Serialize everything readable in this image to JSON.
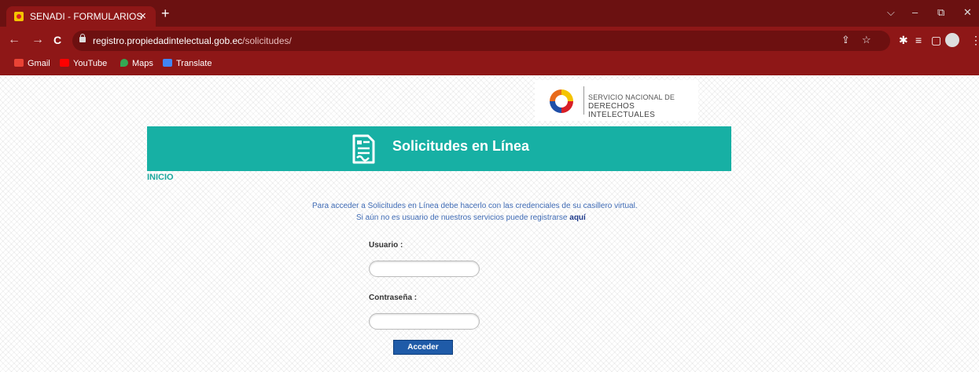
{
  "browser": {
    "tab_title": "SENADI - FORMULARIOS",
    "tab_close": "×",
    "new_tab": "+",
    "window_controls": {
      "dropdown": "⌵",
      "minimize": "–",
      "restore": "⧉",
      "close": "✕"
    },
    "nav": {
      "back": "←",
      "forward": "→",
      "reload": "C"
    },
    "url_host": "registro.propiedadintelectual.gob.ec",
    "url_path": "/solicitudes/",
    "omnibox_icons": {
      "share": "⇪",
      "bookmark": "☆"
    },
    "extension_icons": {
      "extensions": "✱",
      "reading_list": "≡",
      "side_panel": "▢"
    },
    "bookmarks": [
      {
        "label": "Gmail",
        "icon": "gmail-icon",
        "color": "#ea4335"
      },
      {
        "label": "YouTube",
        "icon": "youtube-icon",
        "color": "#ff0000"
      },
      {
        "label": "Maps",
        "icon": "maps-icon",
        "color": "#34a853"
      },
      {
        "label": "Translate",
        "icon": "translate-icon",
        "color": "#4285f4"
      }
    ]
  },
  "page": {
    "logo_line1": "SERVICIO NACIONAL DE",
    "logo_line2": "DERECHOS INTELECTUALES",
    "banner_title": "Solicitudes en Línea",
    "breadcrumb": "INICIO",
    "info_line1": "Para acceder a Solicitudes en Línea debe hacerlo con las credenciales de su casillero virtual.",
    "info_line2": "Si aún no es usuario de nuestros servicios puede registrarse",
    "info_link": "aquí",
    "username_label": "Usuario :",
    "username_value": "",
    "password_label": "Contraseña :",
    "password_value": "",
    "submit_label": "Acceder"
  },
  "colors": {
    "chrome_dark": "#6b1111",
    "chrome": "#8e1717",
    "banner": "#17b0a4",
    "button": "#1f5ba8",
    "info_text": "#3f6bb5"
  }
}
